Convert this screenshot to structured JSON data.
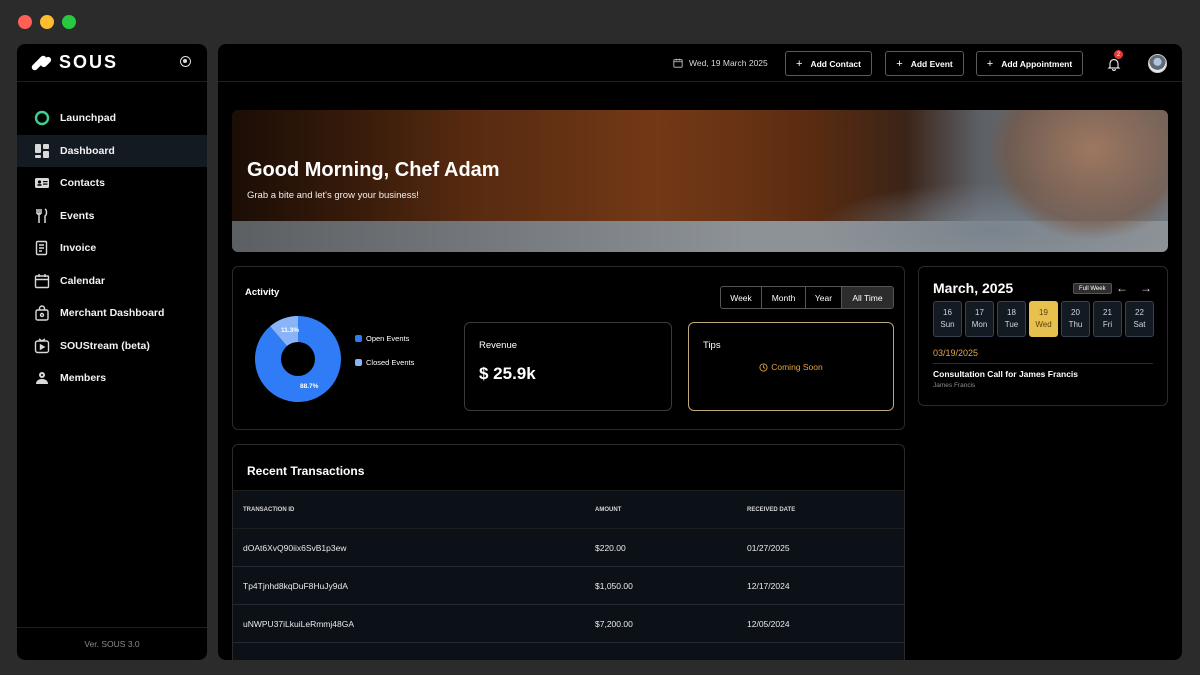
{
  "app": {
    "name": "SOUS",
    "version": "Ver. SOUS 3.0"
  },
  "sidebar": {
    "items": [
      {
        "label": "Launchpad",
        "icon": "launchpad-ring-icon",
        "active": false
      },
      {
        "label": "Dashboard",
        "icon": "dashboard-icon",
        "active": true
      },
      {
        "label": "Contacts",
        "icon": "contact-card-icon",
        "active": false
      },
      {
        "label": "Events",
        "icon": "utensils-icon",
        "active": false
      },
      {
        "label": "Invoice",
        "icon": "invoice-icon",
        "active": false
      },
      {
        "label": "Calendar",
        "icon": "calendar-icon",
        "active": false
      },
      {
        "label": "Merchant Dashboard",
        "icon": "merchant-bag-icon",
        "active": false
      },
      {
        "label": "SOUStream (beta)",
        "icon": "stream-icon",
        "active": false
      },
      {
        "label": "Members",
        "icon": "members-icon",
        "active": false
      }
    ]
  },
  "topbar": {
    "date": "Wed, 19 March 2025",
    "add_contact": "Add Contact",
    "add_event": "Add Event",
    "add_appointment": "Add Appointment",
    "notification_count": "2"
  },
  "hero": {
    "title": "Good Morning, Chef Adam",
    "subtitle": "Grab a bite and let's grow your business!"
  },
  "activity": {
    "title": "Activity",
    "ranges": [
      "Week",
      "Month",
      "Year",
      "All Time"
    ],
    "selected_range": "All Time",
    "legend": [
      {
        "label": "Open Events",
        "color": "#2f7cf6"
      },
      {
        "label": "Closed Events",
        "color": "#8ab4f8"
      }
    ],
    "pie_labels": {
      "open": "88.7%",
      "closed": "11.3%"
    }
  },
  "revenue": {
    "label": "Revenue",
    "value": "$ 25.9k"
  },
  "tips": {
    "label": "Tips",
    "status": "Coming Soon"
  },
  "transactions": {
    "title": "Recent Transactions",
    "columns": [
      "TRANSACTION ID",
      "AMOUNT",
      "RECEIVED DATE"
    ],
    "rows": [
      [
        "dOAt6XvQ90iix6SvB1p3ew",
        "$220.00",
        "01/27/2025"
      ],
      [
        "Tp4Tjnhd8kqDuF8HuJy9dA",
        "$1,050.00",
        "12/17/2024"
      ],
      [
        "uNWPU37iLkuiLeRmmj48GA",
        "$7,200.00",
        "12/05/2024"
      ]
    ]
  },
  "calendar": {
    "month_title": "March, 2025",
    "full_week": "Full Week",
    "days": [
      {
        "num": "16",
        "name": "Sun"
      },
      {
        "num": "17",
        "name": "Mon"
      },
      {
        "num": "18",
        "name": "Tue"
      },
      {
        "num": "19",
        "name": "Wed"
      },
      {
        "num": "20",
        "name": "Thu"
      },
      {
        "num": "21",
        "name": "Fri"
      },
      {
        "num": "22",
        "name": "Sat"
      }
    ],
    "selected_date": "03/19/2025",
    "event_title": "Consultation Call for James Francis",
    "event_person": "James Francis"
  },
  "chart_data": {
    "type": "pie",
    "categories": [
      "Open Events",
      "Closed Events"
    ],
    "values": [
      88.7,
      11.3
    ],
    "colors": [
      "#2f7cf6",
      "#8ab4f8"
    ]
  }
}
